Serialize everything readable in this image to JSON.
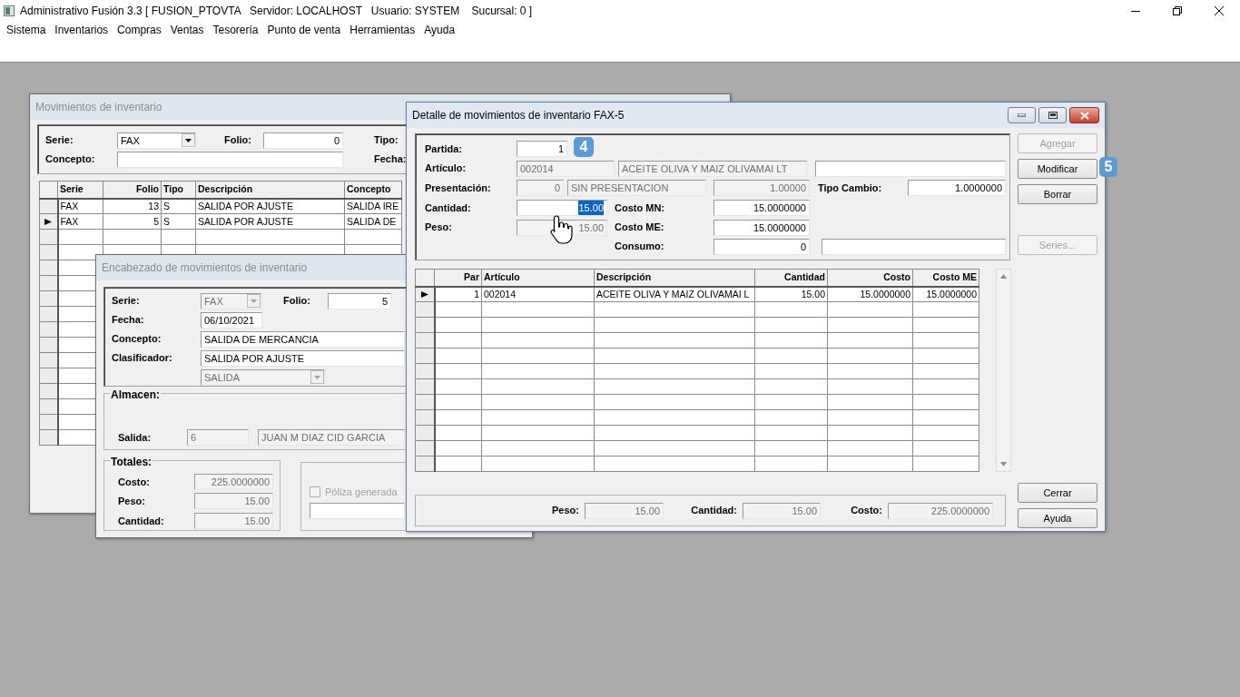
{
  "app": {
    "title": "Administrativo Fusión 3.3 [ FUSION_PTOVTA   Servidor: LOCALHOST   Usuario: SYSTEM    Sucursal: 0 ]",
    "menu": [
      "Sistema",
      "Inventarios",
      "Compras",
      "Ventas",
      "Tesorería",
      "Punto de venta",
      "Herramientas",
      "Ayuda"
    ]
  },
  "movimientos": {
    "title": "Movimientos de inventario",
    "active": false,
    "serie": {
      "label": "Serie:",
      "value": "FAX",
      "disabled": false
    },
    "folio": {
      "label": "Folio:",
      "value": "0",
      "disabled": false
    },
    "tipo": {
      "label": "Tipo:"
    },
    "concepto": {
      "label": "Concepto:",
      "disabled": false
    },
    "fecha": {
      "label": "Fecha:"
    },
    "grid": {
      "columns": [
        "Serie",
        "Folio",
        "Tipo",
        "Descripción",
        "Concepto"
      ],
      "rows": [
        {
          "cells": [
            "FAX",
            "13",
            "S",
            "SALIDA POR AJUSTE",
            "SALIDA IRE"
          ],
          "selected": false
        },
        {
          "cells": [
            "FAX",
            "5",
            "S",
            "SALIDA POR AJUSTE",
            "SALIDA DE"
          ],
          "selected": true
        }
      ]
    }
  },
  "encabezado": {
    "title": "Encabezado de movimientos de inventario",
    "active": false,
    "serie": {
      "label": "Serie:",
      "value": "FAX",
      "disabled": true
    },
    "folio": {
      "label": "Folio:",
      "value": "5",
      "disabled": false
    },
    "fecha": {
      "label": "Fecha:",
      "value": "06/10/2021",
      "disabled": false
    },
    "concepto": {
      "label": "Concepto:",
      "value": "SALIDA DE MERCANCIA",
      "disabled": false
    },
    "clasificador": {
      "label": "Clasificador:",
      "value": "SALIDA POR AJUSTE",
      "disabled": false
    },
    "tipo": {
      "value": "SALIDA",
      "disabled": true
    },
    "almacen": {
      "title": "Almacen:",
      "salida": {
        "label": "Salida:",
        "value": "6",
        "disabled": true
      },
      "nombre": {
        "value": "JUAN M DIAZ CID GARCIA",
        "disabled": true
      }
    },
    "totales": {
      "title": "Totales:",
      "costo": {
        "label": "Costo:",
        "value": "225.0000000",
        "disabled": true
      },
      "peso": {
        "label": "Peso:",
        "value": "15.00",
        "disabled": true
      },
      "cantidad": {
        "label": "Cantidad:",
        "value": "15.00",
        "disabled": true
      }
    },
    "poliza": {
      "label": "Póliza generada",
      "checked": false,
      "disabled": true
    }
  },
  "detalle": {
    "title": "Detalle de movimientos de inventario FAX-5",
    "active": true,
    "partida": {
      "label": "Partida:",
      "value": "1",
      "disabled": false
    },
    "articulo": {
      "label": "Artículo:",
      "code": {
        "value": "002014",
        "disabled": true
      },
      "name": {
        "value": "ACEITE OLIVA Y MAIZ OLIVAMAI LT",
        "disabled": true
      },
      "extra": {
        "disabled": false
      }
    },
    "presentacion": {
      "label": "Presentación:",
      "code": {
        "value": "0",
        "disabled": true
      },
      "name": {
        "value": "SIN PRESENTACION",
        "disabled": true
      },
      "factor": {
        "value": "1.00000",
        "disabled": true
      }
    },
    "tipo_cambio": {
      "label": "Tipo Cambio:",
      "value": "1.0000000",
      "disabled": false
    },
    "cantidad": {
      "label": "Cantidad:",
      "value": "15.00",
      "disabled": false,
      "text_selected": true
    },
    "costo_mn": {
      "label": "Costo MN:",
      "value": "15.0000000",
      "disabled": false
    },
    "peso": {
      "label": "Peso:",
      "value": "15.00",
      "disabled": true
    },
    "costo_me": {
      "label": "Costo ME:",
      "value": "15.0000000",
      "disabled": false
    },
    "consumo": {
      "label": "Consumo:",
      "value": "0",
      "disabled": false
    },
    "consumo_extra": {
      "disabled": false
    },
    "grid": {
      "columns": [
        "Par",
        "Artículo",
        "Descripción",
        "Cantidad",
        "Costo",
        "Costo ME"
      ],
      "rows": [
        {
          "cells": [
            "1",
            "002014",
            "ACEITE OLIVA Y MAIZ OLIVAMAI L",
            "15.00",
            "15.0000000",
            "15.0000000"
          ],
          "selected": true
        }
      ]
    },
    "totales": {
      "peso": {
        "label": "Peso:",
        "value": "15.00",
        "disabled": true
      },
      "cantidad": {
        "label": "Cantidad:",
        "value": "15.00",
        "disabled": true
      },
      "costo": {
        "label": "Costo:",
        "value": "225.0000000",
        "disabled": true
      }
    },
    "buttons": [
      {
        "label": "Agregar",
        "disabled": true
      },
      {
        "label": "Modificar",
        "disabled": false
      },
      {
        "label": "Borrar",
        "disabled": false
      },
      {
        "label": "Series...",
        "disabled": true
      },
      {
        "label": "Cerrar",
        "disabled": false
      },
      {
        "label": "Ayuda",
        "disabled": false
      }
    ]
  },
  "steps": [
    "4",
    "5"
  ]
}
